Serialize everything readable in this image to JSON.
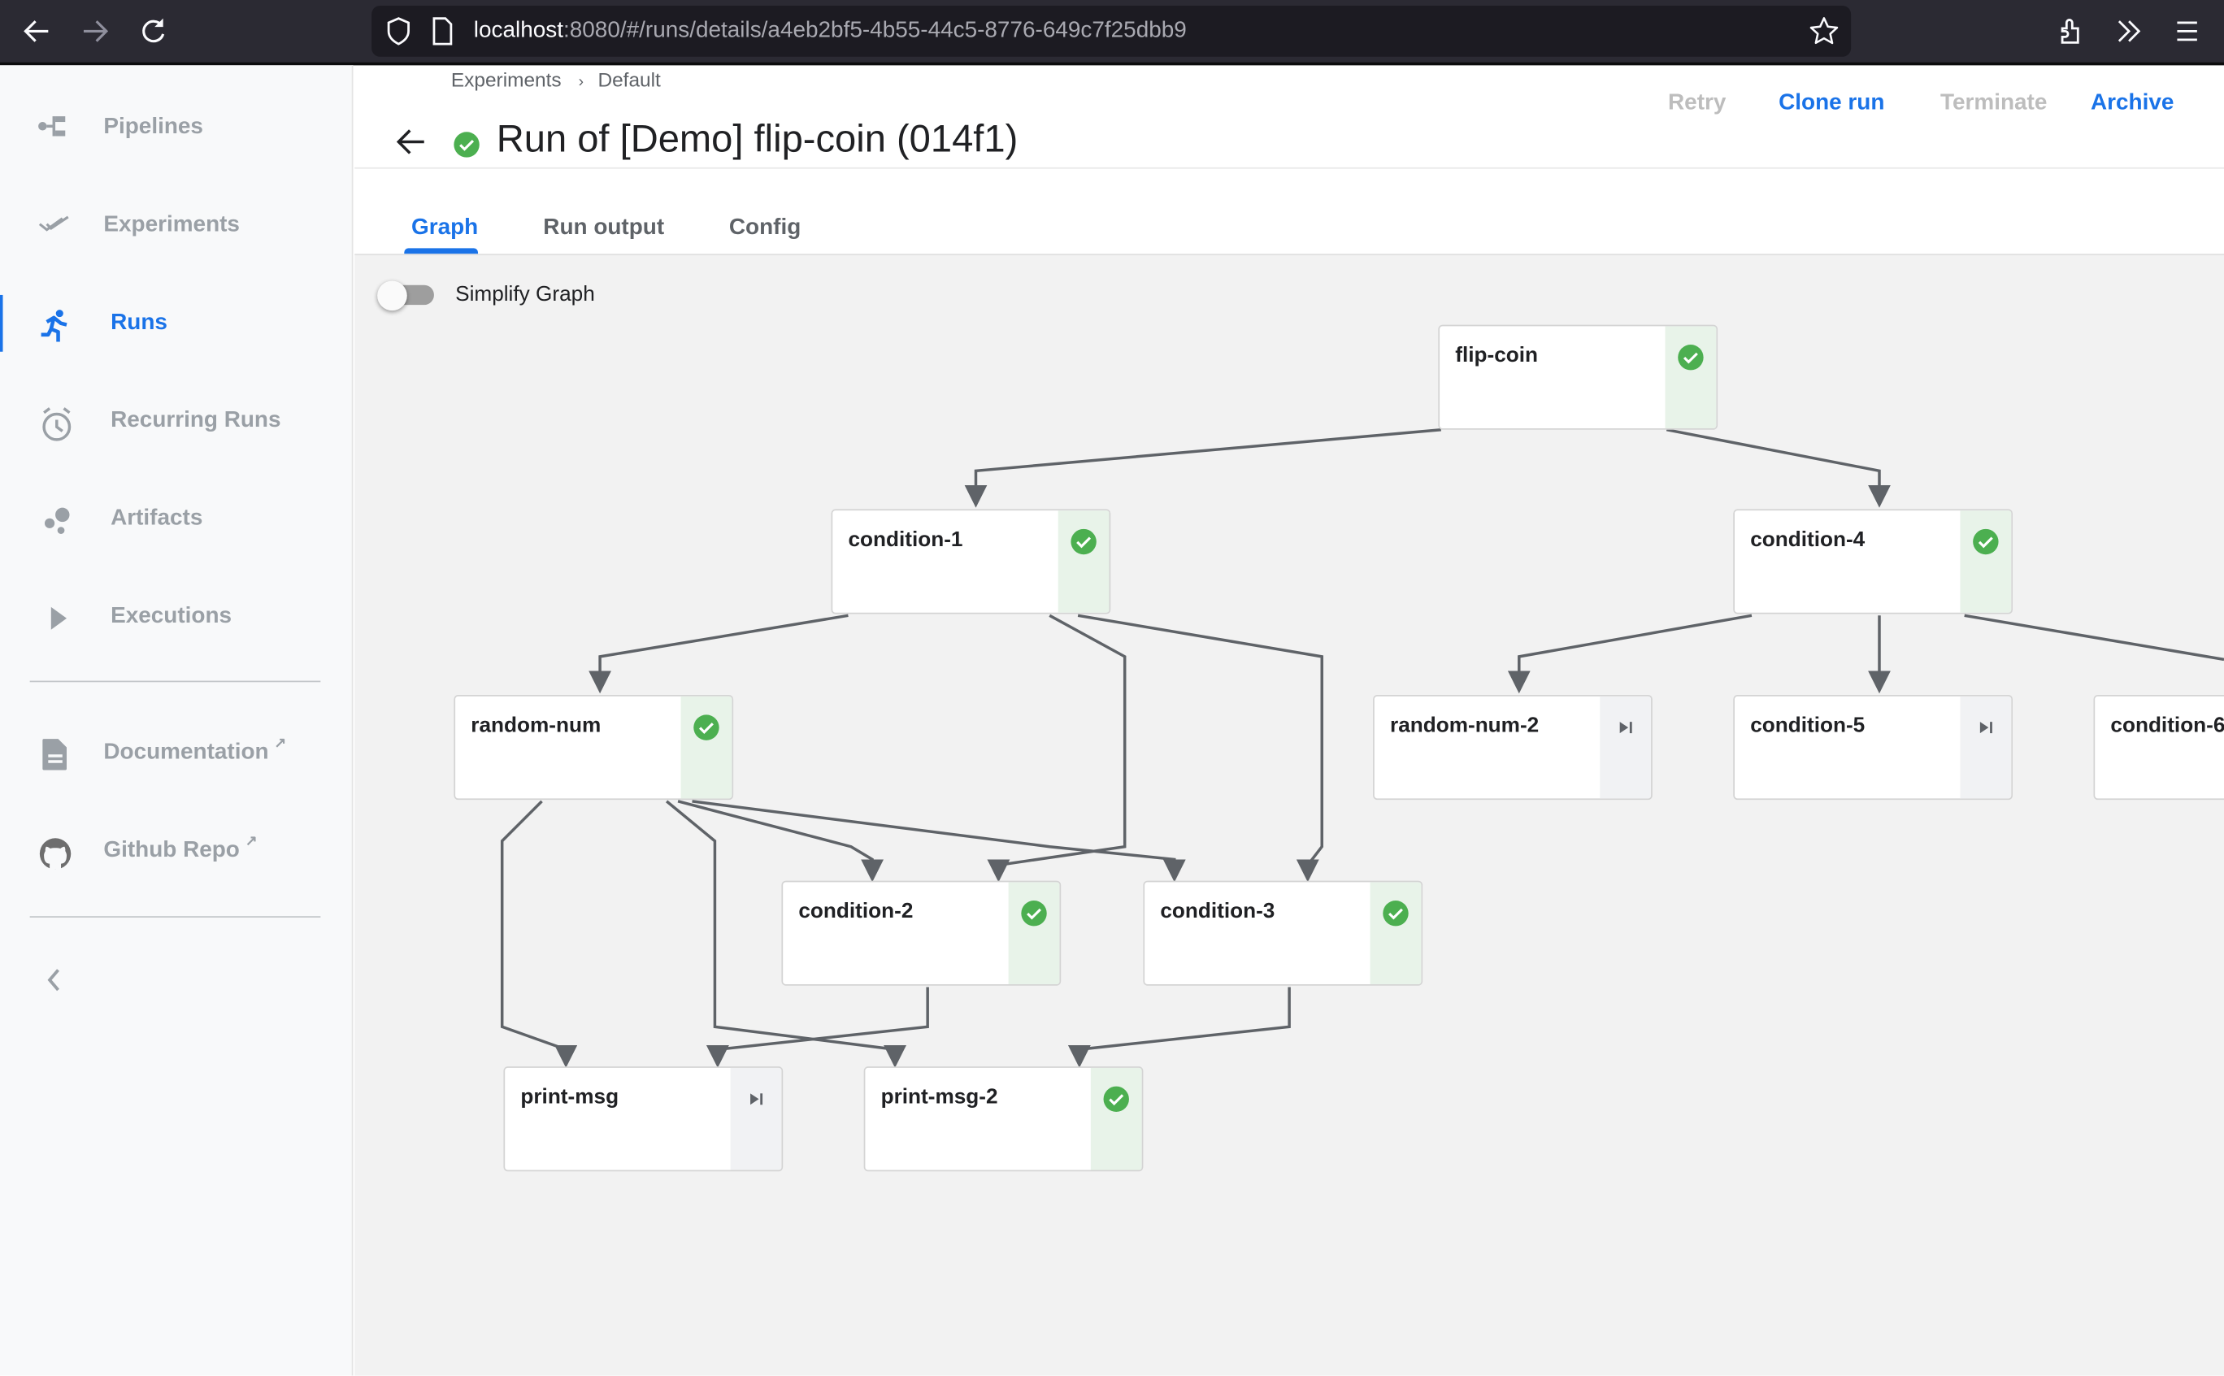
{
  "browser": {
    "url_host": "localhost",
    "url_rest": ":8080/#/runs/details/a4eb2bf5-4b55-44c5-8776-649c7f25dbb9",
    "icons": [
      "back-icon",
      "forward-icon",
      "reload-icon",
      "shield-icon",
      "page-icon",
      "bookmark-star-icon",
      "extensions-icon",
      "overflow-chevrons-icon",
      "menu-icon"
    ]
  },
  "sidebar": {
    "items": [
      {
        "label": "Pipelines",
        "icon": "pipelines-icon",
        "active": false
      },
      {
        "label": "Experiments",
        "icon": "experiments-icon",
        "active": false
      },
      {
        "label": "Runs",
        "icon": "runs-icon",
        "active": true
      },
      {
        "label": "Recurring Runs",
        "icon": "alarm-clock-icon",
        "active": false
      },
      {
        "label": "Artifacts",
        "icon": "artifacts-icon",
        "active": false
      },
      {
        "label": "Executions",
        "icon": "play-icon",
        "active": false
      }
    ],
    "external": [
      {
        "label": "Documentation",
        "icon": "document-icon",
        "ext_icon": "external-link-icon"
      },
      {
        "label": "Github Repo",
        "icon": "github-icon",
        "ext_icon": "external-link-icon"
      }
    ],
    "collapse_icon": "chevron-left-icon"
  },
  "header": {
    "breadcrumbs": [
      "Experiments",
      "Default"
    ],
    "breadcrumb_separator": "›",
    "title": "Run of [Demo] flip-coin (014f1)",
    "status": "succeeded",
    "actions": [
      {
        "label": "Retry",
        "enabled": false
      },
      {
        "label": "Clone run",
        "enabled": true
      },
      {
        "label": "Terminate",
        "enabled": false
      },
      {
        "label": "Archive",
        "enabled": true
      }
    ]
  },
  "tabs": [
    {
      "label": "Graph",
      "active": true
    },
    {
      "label": "Run output",
      "active": false
    },
    {
      "label": "Config",
      "active": false
    }
  ],
  "graph": {
    "simplify_label": "Simplify Graph",
    "simplify_on": false,
    "colors": {
      "success": "#4caf50",
      "edge": "#5f6368",
      "accent": "#1a73e8"
    },
    "nodes": [
      {
        "id": "flip-coin",
        "label": "flip-coin",
        "status": "succeeded"
      },
      {
        "id": "condition-1",
        "label": "condition-1",
        "status": "succeeded"
      },
      {
        "id": "condition-4",
        "label": "condition-4",
        "status": "succeeded"
      },
      {
        "id": "random-num",
        "label": "random-num",
        "status": "succeeded"
      },
      {
        "id": "random-num-2",
        "label": "random-num-2",
        "status": "skipped"
      },
      {
        "id": "condition-5",
        "label": "condition-5",
        "status": "skipped"
      },
      {
        "id": "condition-6",
        "label": "condition-6",
        "status": "unknown"
      },
      {
        "id": "condition-2",
        "label": "condition-2",
        "status": "succeeded"
      },
      {
        "id": "condition-3",
        "label": "condition-3",
        "status": "succeeded"
      },
      {
        "id": "print-msg",
        "label": "print-msg",
        "status": "skipped"
      },
      {
        "id": "print-msg-2",
        "label": "print-msg-2",
        "status": "succeeded"
      }
    ],
    "edges": [
      [
        "flip-coin",
        "condition-1"
      ],
      [
        "flip-coin",
        "condition-4"
      ],
      [
        "condition-1",
        "random-num"
      ],
      [
        "condition-1",
        "condition-2"
      ],
      [
        "condition-1",
        "condition-3"
      ],
      [
        "condition-4",
        "random-num-2"
      ],
      [
        "condition-4",
        "condition-5"
      ],
      [
        "condition-4",
        "condition-6"
      ],
      [
        "random-num",
        "print-msg"
      ],
      [
        "random-num",
        "print-msg-2"
      ],
      [
        "random-num",
        "condition-2"
      ],
      [
        "random-num",
        "condition-3"
      ],
      [
        "condition-2",
        "print-msg"
      ],
      [
        "condition-3",
        "print-msg-2"
      ]
    ]
  }
}
